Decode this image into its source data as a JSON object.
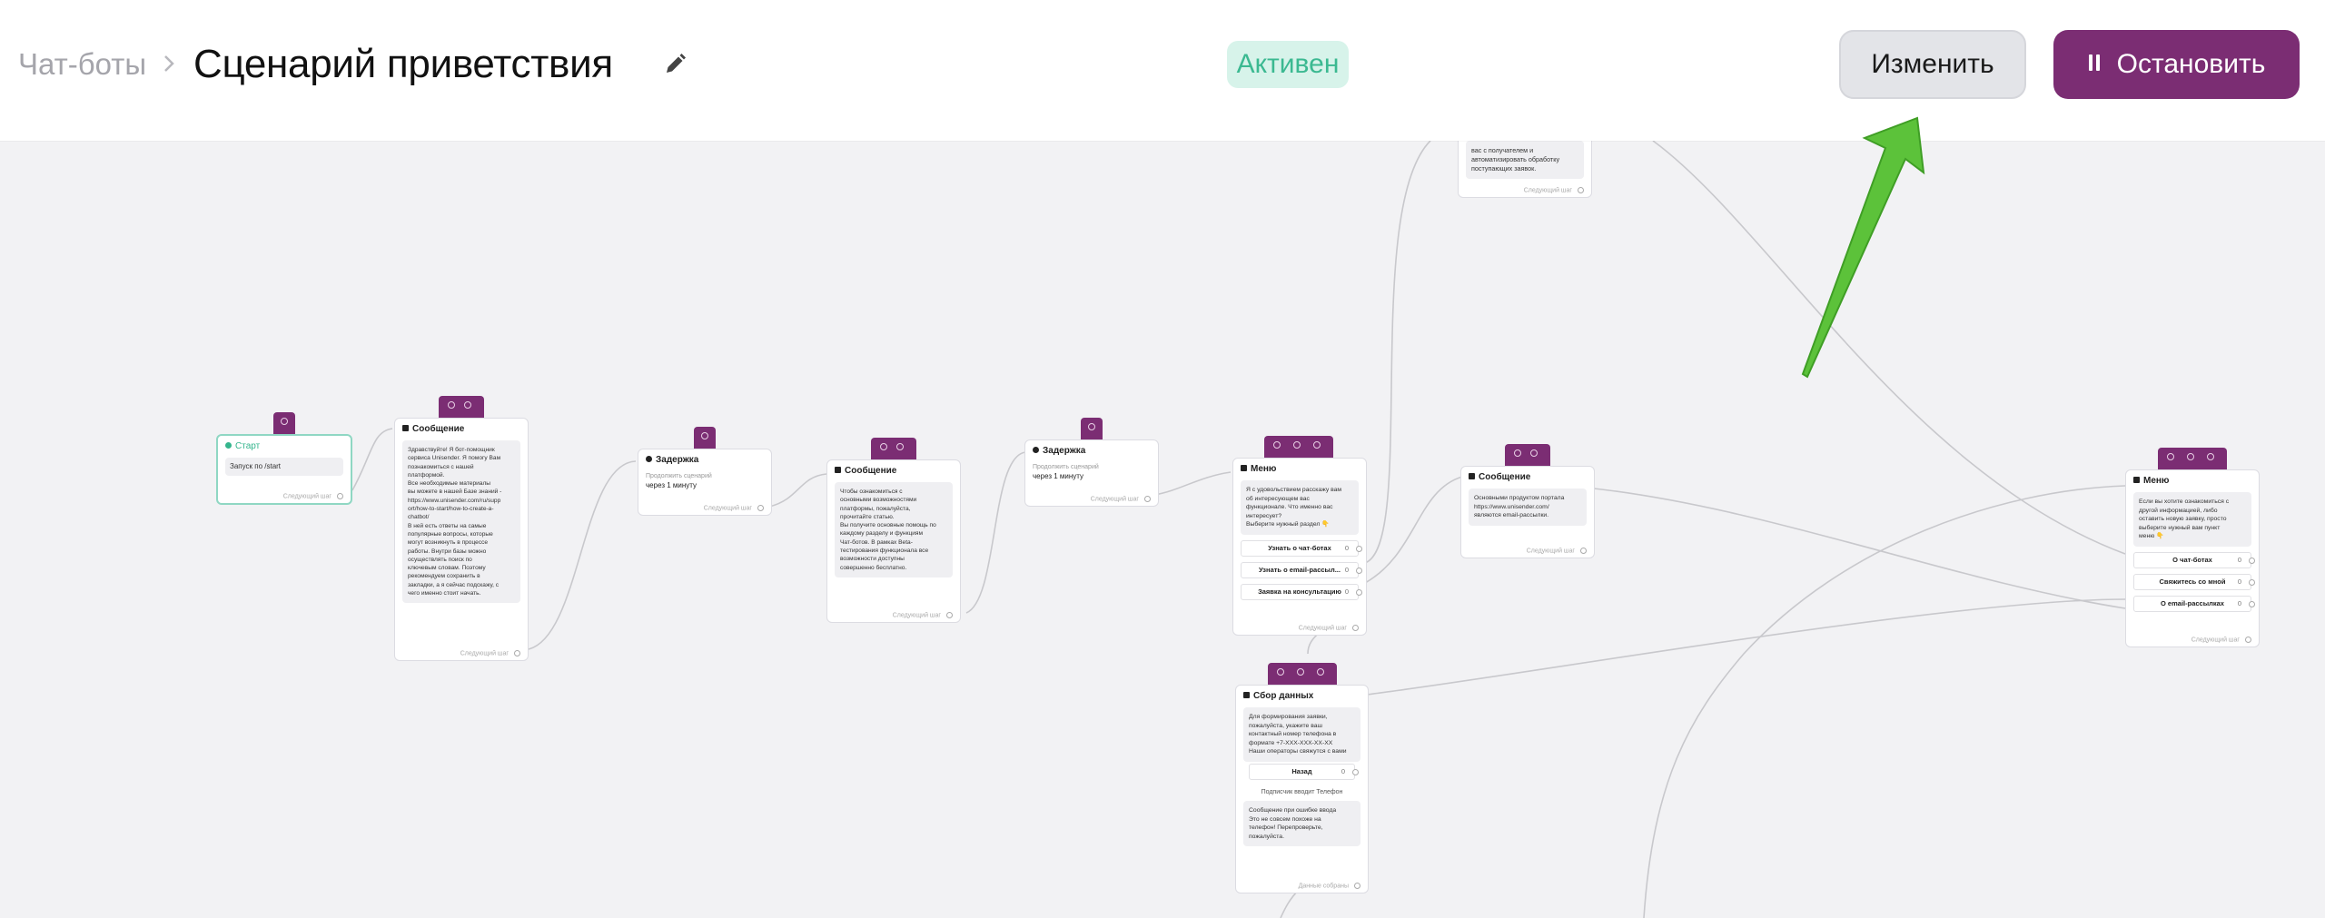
{
  "header": {
    "breadcrumb": "Чат-боты",
    "title": "Сценарий приветствия",
    "status": "Активен",
    "edit_button": "Изменить",
    "stop_button": "Остановить"
  },
  "colors": {
    "accent": "#7b2d73",
    "status_bg": "#d7f3ea",
    "status_text": "#3bb991",
    "arrow": "#5cc23a"
  },
  "nodes": {
    "top_partial": {
      "text": "вас с получателем и\nавтоматизировать обработку\nпоступающих заявок.",
      "footer": "Следующий шаг"
    },
    "start": {
      "title": "Старт",
      "trigger": "Запуск по /start",
      "footer": "Следующий шаг"
    },
    "msg1": {
      "title": "Сообщение",
      "text": "Здравствуйте! Я бот-помощник\nсервиса Unisender. Я помогу Вам\nпознакомиться с нашей\nплатформой.\nВсе необходимые материалы\nвы можете в нашей Базе знаний -\nhttps://www.unisender.com/ru/supp\nort/how-to-start/how-to-create-a-\nchatbot/\nВ ней есть ответы на самые\nпопулярные вопросы, которые\nмогут возникнуть в процессе\nработы. Внутри базы можно\nосуществлять поиск по\nключевым словам. Поэтому\nрекомендуем сохранить в\nзакладки, а я сейчас подскажу, с\nчего именно стоит начать.",
      "footer": "Следующий шаг"
    },
    "delay1": {
      "title": "Задержка",
      "label": "Продолжить сценарий",
      "value": "через 1 минуту",
      "footer": "Следующий шаг"
    },
    "msg2": {
      "title": "Сообщение",
      "text": "Чтобы ознакомиться с\nосновными возможностями\nплатформы, пожалуйста,\nпрочитайте статью.\nВы получите основные помощь по\nкаждому разделу и функциям\nЧат-ботов. В рамках Beta-\nтестирования функционала все\nвозможности доступны\nсовершенно бесплатно.",
      "footer": "Следующий шаг"
    },
    "delay2": {
      "title": "Задержка",
      "label": "Продолжить сценарий",
      "value": "через 1 минуту",
      "footer": "Следующий шаг"
    },
    "menu1": {
      "title": "Меню",
      "text": "Я с удовольствием расскажу вам\nоб интересующем вас\nфункционале. Что именно вас\nинтересует?\nВыберите нужный раздел 👇",
      "buttons": [
        {
          "label": "Узнать о чат-ботах",
          "count": "0"
        },
        {
          "label": "Узнать о email-рассыл...",
          "count": "0"
        },
        {
          "label": "Заявка на консультацию",
          "count": "0"
        }
      ],
      "footer": "Следующий шаг"
    },
    "msg3": {
      "title": "Сообщение",
      "text": "Основными продуктом портала\nhttps://www.unisender.com/\nявляются email-рассылки.",
      "footer": "Следующий шаг"
    },
    "collect": {
      "title": "Сбор данных",
      "text": "Для формирования заявки,\nпожалуйста, укажите ваш\nконтактный номер телефона в\nформате +7-XXX-XXX-XX-XX\nНаши операторы свяжутся с вами",
      "button": {
        "label": "Назад",
        "count": "0"
      },
      "caption": "Подписчик вводит Телефон",
      "error_text": "Сообщение при ошибке ввода\nЭто не совсем похоже на\nтелефон! Перепроверьте,\nпожалуйста.",
      "footer": "Данные собраны"
    },
    "menu2": {
      "title": "Меню",
      "text": "Если вы хотите ознакомиться с\nдругой информацией, либо\nоставить новую заявку, просто\nвыберите нужный вам пункт\nменю 👇",
      "buttons": [
        {
          "label": "О чат-ботах",
          "count": "0"
        },
        {
          "label": "Свяжитесь со мной",
          "count": "0"
        },
        {
          "label": "О email-рассылках",
          "count": "0"
        }
      ],
      "footer": "Следующий шаг"
    }
  }
}
